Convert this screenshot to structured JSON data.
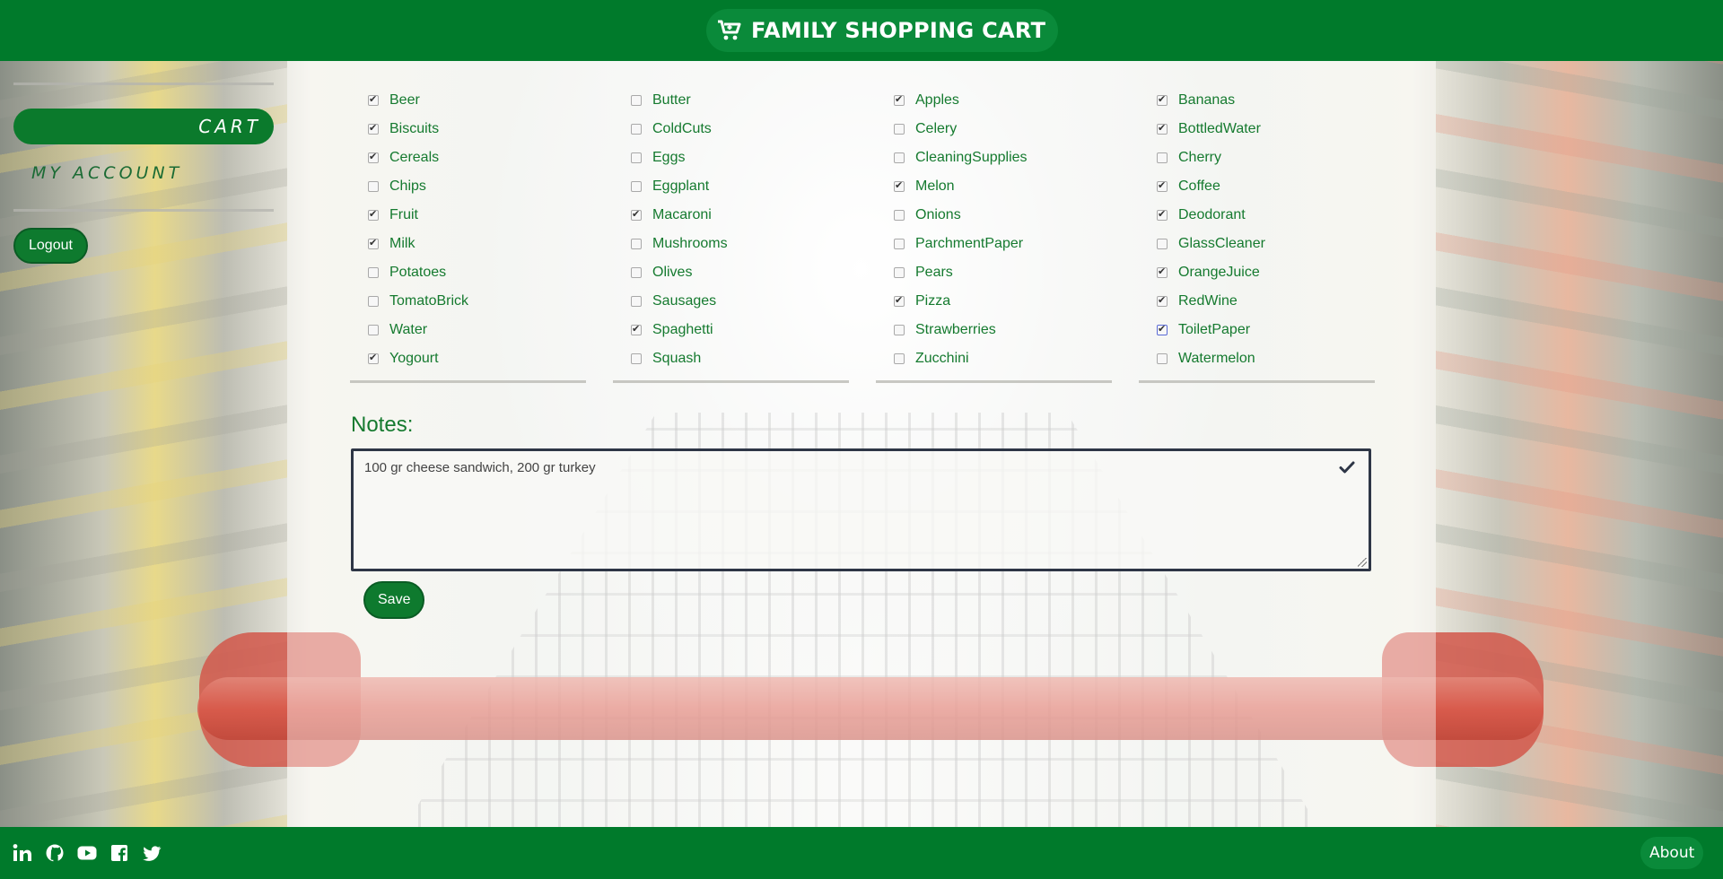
{
  "header": {
    "title": "FAMILY SHOPPING CART",
    "icon": "shopping-cart-icon"
  },
  "sidebar": {
    "cart_label": "CART",
    "account_label": "MY ACCOUNT",
    "logout_label": "Logout"
  },
  "columns": [
    [
      {
        "label": "Beer",
        "checked": true
      },
      {
        "label": "Biscuits",
        "checked": true
      },
      {
        "label": "Cereals",
        "checked": true
      },
      {
        "label": "Chips",
        "checked": false
      },
      {
        "label": "Fruit",
        "checked": true
      },
      {
        "label": "Milk",
        "checked": true
      },
      {
        "label": "Potatoes",
        "checked": false
      },
      {
        "label": "TomatoBrick",
        "checked": false
      },
      {
        "label": "Water",
        "checked": false
      },
      {
        "label": "Yogourt",
        "checked": true
      }
    ],
    [
      {
        "label": "Butter",
        "checked": false
      },
      {
        "label": "ColdCuts",
        "checked": false
      },
      {
        "label": "Eggs",
        "checked": false
      },
      {
        "label": "Eggplant",
        "checked": false
      },
      {
        "label": "Macaroni",
        "checked": true
      },
      {
        "label": "Mushrooms",
        "checked": false
      },
      {
        "label": "Olives",
        "checked": false
      },
      {
        "label": "Sausages",
        "checked": false
      },
      {
        "label": "Spaghetti",
        "checked": true
      },
      {
        "label": "Squash",
        "checked": false
      }
    ],
    [
      {
        "label": "Apples",
        "checked": true
      },
      {
        "label": "Celery",
        "checked": false
      },
      {
        "label": "CleaningSupplies",
        "checked": false
      },
      {
        "label": "Melon",
        "checked": true
      },
      {
        "label": "Onions",
        "checked": false
      },
      {
        "label": "ParchmentPaper",
        "checked": false
      },
      {
        "label": "Pears",
        "checked": false
      },
      {
        "label": "Pizza",
        "checked": true
      },
      {
        "label": "Strawberries",
        "checked": false
      },
      {
        "label": "Zucchini",
        "checked": false
      }
    ],
    [
      {
        "label": "Bananas",
        "checked": true
      },
      {
        "label": "BottledWater",
        "checked": true
      },
      {
        "label": "Cherry",
        "checked": false
      },
      {
        "label": "Coffee",
        "checked": true
      },
      {
        "label": "Deodorant",
        "checked": true
      },
      {
        "label": "GlassCleaner",
        "checked": false
      },
      {
        "label": "OrangeJuice",
        "checked": true
      },
      {
        "label": "RedWine",
        "checked": true
      },
      {
        "label": "ToiletPaper",
        "checked": true,
        "focused": true
      },
      {
        "label": "Watermelon",
        "checked": false
      }
    ]
  ],
  "notes": {
    "title": "Notes:",
    "value": "100 gr cheese sandwich, 200 gr turkey",
    "check_icon": "checkmark-icon"
  },
  "save_label": "Save",
  "footer": {
    "socials": [
      "linkedin-icon",
      "github-icon",
      "youtube-icon",
      "facebook-icon",
      "twitter-icon"
    ],
    "about_label": "About"
  },
  "colors": {
    "brand_green": "#007a2b",
    "label_green": "#157a2f",
    "button_green": "#0e7a2e"
  }
}
